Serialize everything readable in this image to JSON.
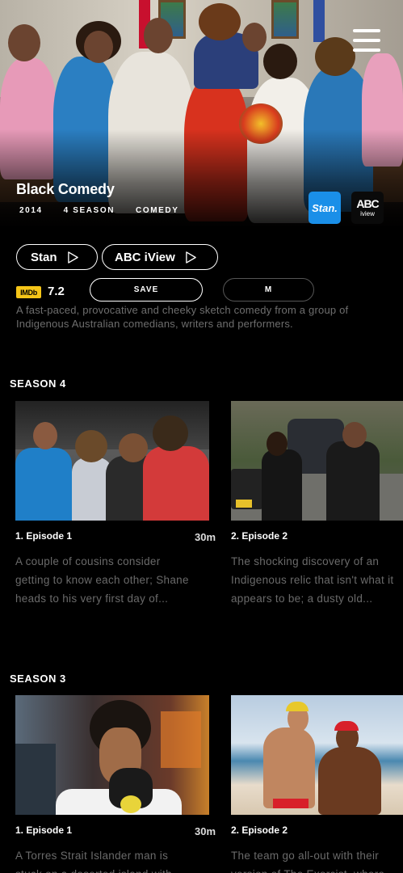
{
  "show": {
    "title": "Black Comedy",
    "meta": [
      "2014",
      "4 SEASON",
      "COMEDY"
    ],
    "description": "A fast-paced, provocative and cheeky sketch comedy from a group of Indigenous Australian comedians, writers and performers."
  },
  "providers": {
    "stan_badge": "Stan.",
    "abc_badge_logo": "ABC",
    "abc_badge_label": "iview",
    "watch_buttons": [
      "Stan",
      "ABC iView"
    ]
  },
  "rating": {
    "source": "IMDb",
    "score": "7.2"
  },
  "actions": {
    "save": "SAVE",
    "more": "M"
  },
  "seasons": [
    {
      "title": "SEASON 4",
      "episodes": [
        {
          "title": "1. Episode 1",
          "duration": "30m",
          "lines": [
            "A couple of cousins consider",
            "getting to know each other; Shane",
            "heads to his very first day of..."
          ]
        },
        {
          "title": "2. Episode 2",
          "duration": "",
          "lines": [
            "The shocking discovery of an",
            "Indigenous relic that isn't what it",
            "appears to be; a dusty old..."
          ]
        }
      ]
    },
    {
      "title": "SEASON 3",
      "episodes": [
        {
          "title": "1. Episode 1",
          "duration": "30m",
          "lines": [
            "A Torres Strait Islander man is",
            "stuck on a deserted island with"
          ]
        },
        {
          "title": "2. Episode 2",
          "duration": "",
          "lines": [
            "The team go all-out with their",
            "version of The Exorcist, where"
          ]
        }
      ]
    }
  ],
  "icons": {
    "menu": "hamburger-menu-icon",
    "play": "play-outline-icon"
  },
  "colors": {
    "stan": "#1a8fe8",
    "imdb": "#f5c518",
    "background": "#000000",
    "muted_text": "#6e6e6e"
  }
}
